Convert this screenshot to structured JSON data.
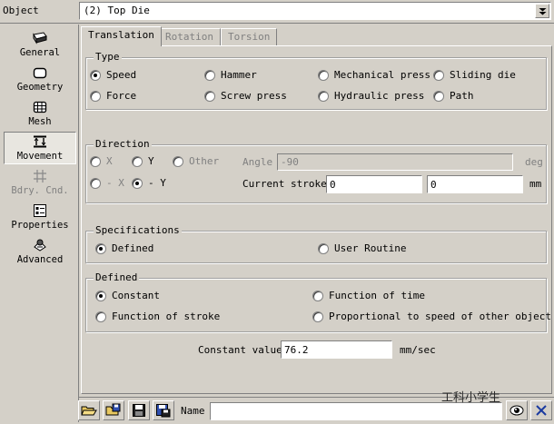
{
  "object_bar": {
    "label": "Object",
    "value": "(2) Top Die"
  },
  "sidebar": {
    "items": [
      {
        "label": "General",
        "icon": "general-icon"
      },
      {
        "label": "Geometry",
        "icon": "geometry-icon"
      },
      {
        "label": "Mesh",
        "icon": "mesh-icon"
      },
      {
        "label": "Movement",
        "icon": "movement-icon",
        "selected": true
      },
      {
        "label": "Bdry. Cnd.",
        "icon": "boundary-condition-icon",
        "disabled": true
      },
      {
        "label": "Properties",
        "icon": "properties-icon"
      },
      {
        "label": "Advanced",
        "icon": "advanced-icon"
      }
    ]
  },
  "tabs": [
    {
      "label": "Translation",
      "active": true
    },
    {
      "label": "Rotation",
      "active": false
    },
    {
      "label": "Torsion",
      "active": false
    }
  ],
  "type_group": {
    "title": "Type",
    "options": [
      {
        "label": "Speed",
        "selected": true
      },
      {
        "label": "Hammer"
      },
      {
        "label": "Mechanical press"
      },
      {
        "label": "Sliding die"
      },
      {
        "label": "Force"
      },
      {
        "label": "Screw press"
      },
      {
        "label": "Hydraulic press"
      },
      {
        "label": "Path"
      }
    ]
  },
  "direction_group": {
    "title": "Direction",
    "options": [
      {
        "label": "X"
      },
      {
        "label": "Y"
      },
      {
        "label": "Other"
      },
      {
        "label": "- X"
      },
      {
        "label": "- Y",
        "selected": true
      }
    ],
    "angle_label": "Angle",
    "angle_value": "-90",
    "angle_unit": "deg",
    "stroke_label": "Current stroke",
    "stroke_x": "0",
    "stroke_y": "0",
    "stroke_unit": "mm"
  },
  "specifications_group": {
    "title": "Specifications",
    "options": [
      {
        "label": "Defined",
        "selected": true
      },
      {
        "label": "User Routine"
      }
    ]
  },
  "defined_group": {
    "title": "Defined",
    "options": [
      {
        "label": "Constant",
        "selected": true
      },
      {
        "label": "Function of time"
      },
      {
        "label": "Function of stroke"
      },
      {
        "label": "Proportional to speed of other object"
      }
    ]
  },
  "constant": {
    "label": "Constant value",
    "value": "76.2",
    "unit": "mm/sec"
  },
  "bottom_bar": {
    "name_label": "Name",
    "name_value": "",
    "watermark": "工科小学生",
    "buttons": [
      "open-folder-icon",
      "save-folder-icon",
      "save-disk-icon",
      "save-as-disk-icon",
      "eye-view-icon",
      "close-x-icon"
    ]
  }
}
